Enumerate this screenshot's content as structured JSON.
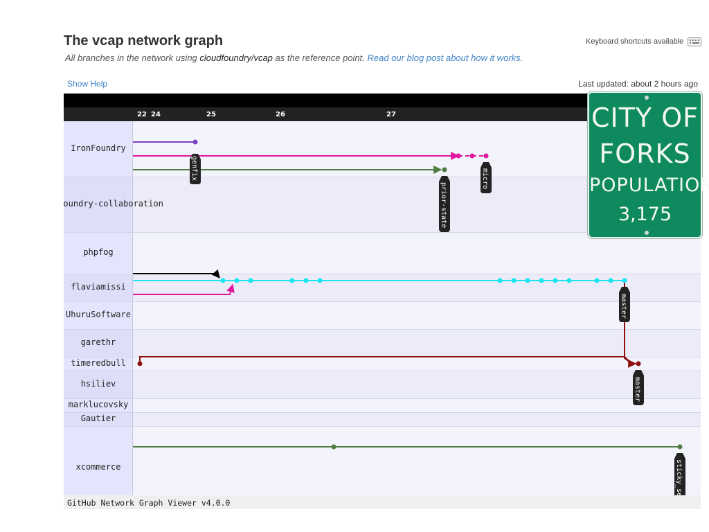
{
  "header": {
    "title": "The vcap network graph",
    "subtitle_prefix": "All branches in the network using ",
    "subtitle_repo": "cloudfoundry/vcap",
    "subtitle_suffix": " as the reference point. ",
    "blog_link": "Read our blog post about how it works.",
    "shortcuts": "Keyboard shortcuts available",
    "shortcuts_icon": "keyboard-icon",
    "show_help": "Show Help",
    "last_updated": "Last updated: about 2 hours ago"
  },
  "graph": {
    "date_labels": [
      "22",
      "24",
      "25",
      "26",
      "27"
    ],
    "users": [
      "IronFoundry",
      "cloudfoundry-collaboration",
      "phpfog",
      "flaviamissi",
      "UhuruSoftware",
      "garethr",
      "timeredbull",
      "hsiliev",
      "marklucovsky",
      "Gautier",
      "xcommerce"
    ],
    "branch_labels": [
      "genfix",
      "prior-state",
      "micro",
      "master",
      "master",
      "sticky_se"
    ],
    "footer": "GitHub Network Graph Viewer v4.0.0",
    "colors": {
      "purple": "#7c3fc2",
      "pink": "#e0169f",
      "green": "#4f7d3f",
      "black": "#000000",
      "cyan": "#19e6f0",
      "maroon": "#8b0f0f",
      "header_bg": "#000000",
      "date_bg": "#222222"
    }
  },
  "sign": {
    "line1": "CITY OF",
    "line2": "FORKS",
    "line3": "POPULATION",
    "line4": "3,175",
    "bg_color": "#0f8a5f"
  }
}
